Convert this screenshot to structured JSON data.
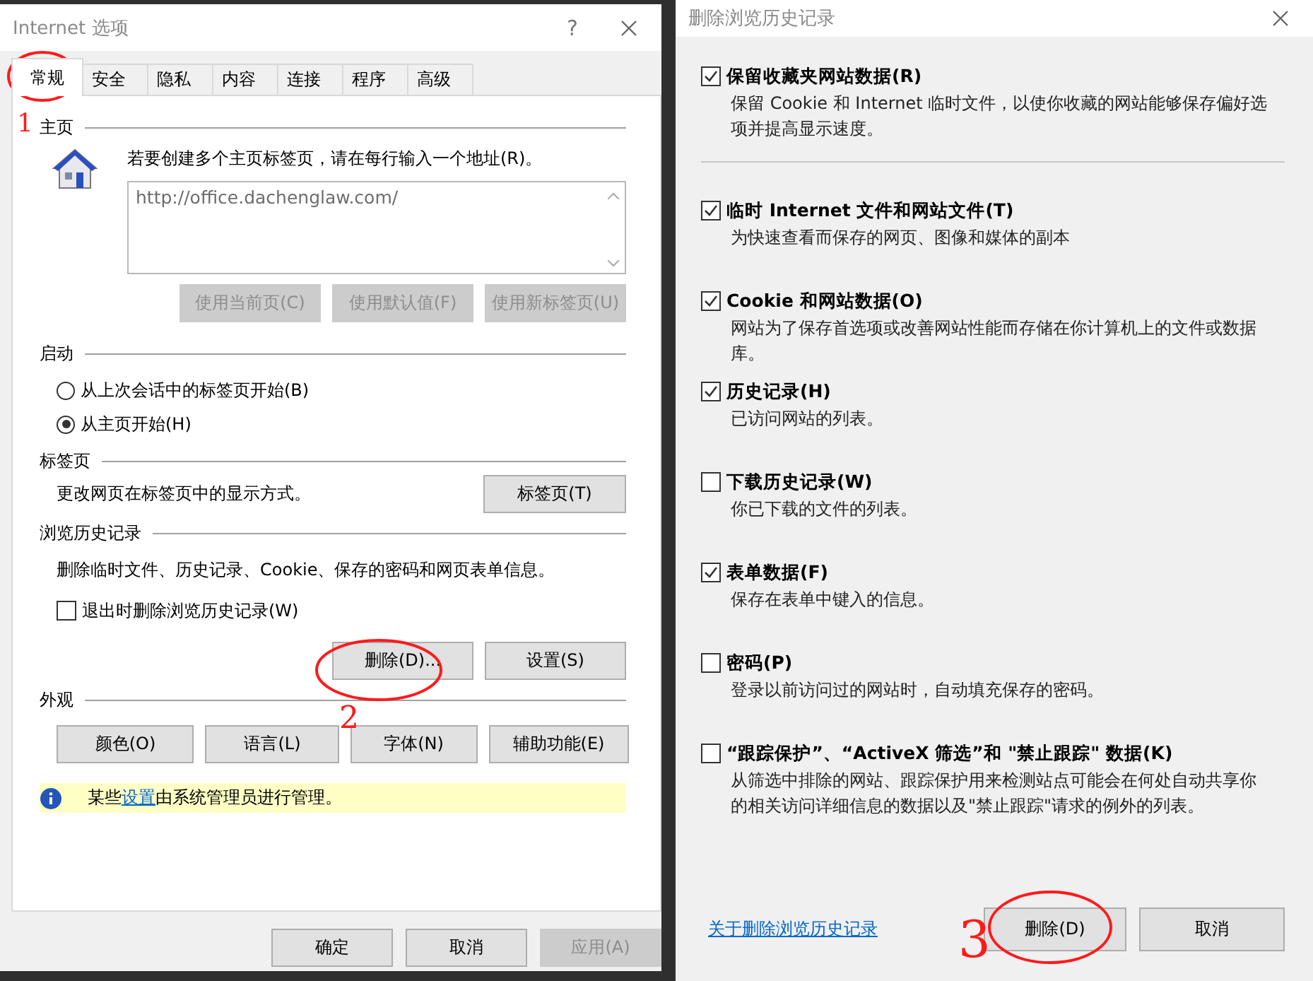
{
  "options_window": {
    "title": "Internet 选项",
    "help": "?",
    "tabs": [
      {
        "label": "常规",
        "selected": true
      },
      {
        "label": "安全",
        "selected": false
      },
      {
        "label": "隐私",
        "selected": false
      },
      {
        "label": "内容",
        "selected": false
      },
      {
        "label": "连接",
        "selected": false
      },
      {
        "label": "程序",
        "selected": false
      },
      {
        "label": "高级",
        "selected": false
      }
    ],
    "home_page": {
      "heading": "主页",
      "instruction": "若要创建多个主页标签页，请在每行输入一个地址(R)。",
      "address": "http://office.dachenglaw.com/",
      "buttons": [
        {
          "label": "使用当前页(C)",
          "disabled": true
        },
        {
          "label": "使用默认值(F)",
          "disabled": true
        },
        {
          "label": "使用新标签页(U)",
          "disabled": true
        }
      ]
    },
    "startup": {
      "heading": "启动",
      "options": [
        {
          "label": "从上次会话中的标签页开始(B)",
          "selected": false
        },
        {
          "label": "从主页开始(H)",
          "selected": true
        }
      ]
    },
    "tabs_section": {
      "heading": "标签页",
      "description": "更改网页在标签页中的显示方式。",
      "button": "标签页(T)"
    },
    "browsing_history": {
      "heading": "浏览历史记录",
      "description": "删除临时文件、历史记录、Cookie、保存的密码和网页表单信息。",
      "delete_on_exit": {
        "label": "退出时删除浏览历史记录(W)",
        "checked": false
      },
      "buttons": [
        "删除(D)...",
        "设置(S)"
      ]
    },
    "appearance": {
      "heading": "外观",
      "buttons": [
        "颜色(O)",
        "语言(L)",
        "字体(N)",
        "辅助功能(E)"
      ]
    },
    "notice": {
      "before": "某些",
      "link": "设置",
      "after": "由系统管理员进行管理。"
    },
    "footer_buttons": [
      {
        "label": "确定",
        "disabled": false
      },
      {
        "label": "取消",
        "disabled": false
      },
      {
        "label": "应用(A)",
        "disabled": true
      }
    ]
  },
  "delete_window": {
    "title": "删除浏览历史记录",
    "items": [
      {
        "label": "保留收藏夹网站数据(R)",
        "description": "保留 Cookie 和 Internet 临时文件，以使你收藏的网站能够保存偏好选项并提高显示速度。",
        "checked": true
      },
      {
        "label": "临时 Internet 文件和网站文件(T)",
        "description": "为快速查看而保存的网页、图像和媒体的副本",
        "checked": true
      },
      {
        "label": "Cookie 和网站数据(O)",
        "description": "网站为了保存首选项或改善网站性能而存储在你计算机上的文件或数据库。",
        "checked": true
      },
      {
        "label": "历史记录(H)",
        "description": "已访问网站的列表。",
        "checked": true
      },
      {
        "label": "下载历史记录(W)",
        "description": "你已下载的文件的列表。",
        "checked": false
      },
      {
        "label": "表单数据(F)",
        "description": "保存在表单中键入的信息。",
        "checked": true
      },
      {
        "label": "密码(P)",
        "description": "登录以前访问过的网站时，自动填充保存的密码。",
        "checked": false
      },
      {
        "label": "“跟踪保护”、“ActiveX 筛选”和 \"禁止跟踪\" 数据(K)",
        "description": "从筛选中排除的网站、跟踪保护用来检测站点可能会在何处自动共享你的相关访问详细信息的数据以及\"禁止跟踪\"请求的例外的列表。",
        "checked": false
      }
    ],
    "link": "关于删除浏览历史记录",
    "buttons": [
      "删除(D)",
      "取消"
    ]
  },
  "annotations": [
    {
      "label": "1"
    },
    {
      "label": "2"
    },
    {
      "label": "3"
    }
  ]
}
